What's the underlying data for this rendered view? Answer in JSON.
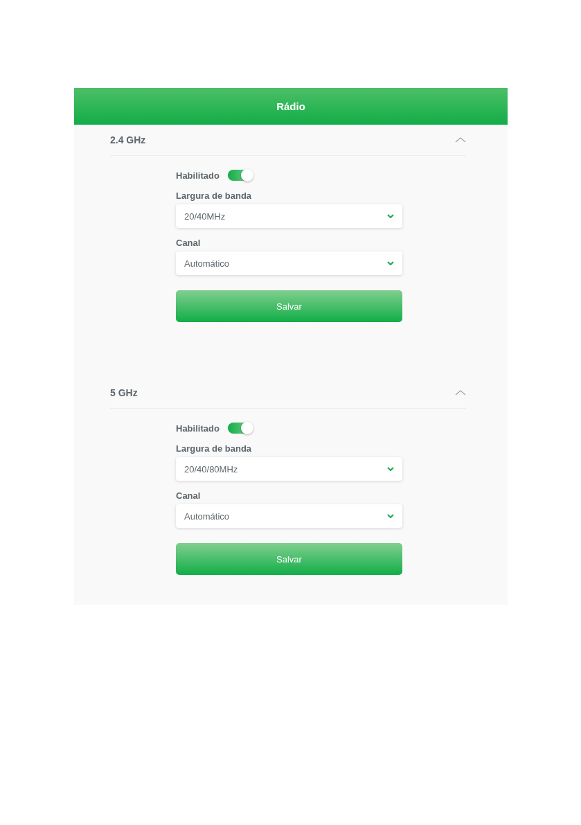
{
  "header": {
    "title": "Rádio"
  },
  "sections": [
    {
      "title": "2.4 GHz",
      "expanded": true,
      "enabled": {
        "label": "Habilitado",
        "on": true
      },
      "fields": [
        {
          "label": "Largura de banda",
          "value": "20/40MHz"
        },
        {
          "label": "Canal",
          "value": "Automático"
        }
      ],
      "button": "Salvar"
    },
    {
      "title": "5 GHz",
      "expanded": true,
      "enabled": {
        "label": "Habilitado",
        "on": true
      },
      "fields": [
        {
          "label": "Largura de banda",
          "value": "20/40/80MHz"
        },
        {
          "label": "Canal",
          "value": "Automático"
        }
      ],
      "button": "Salvar"
    }
  ]
}
